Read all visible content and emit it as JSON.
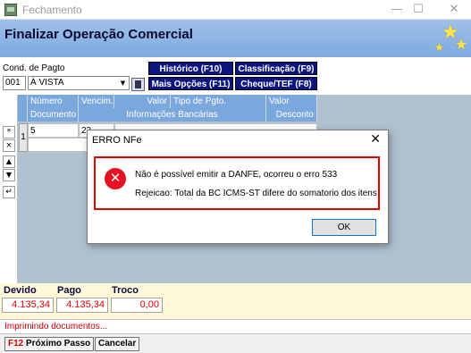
{
  "window": {
    "title": "Fechamento",
    "minimize": "—",
    "maximize": "☐",
    "close": "✕"
  },
  "header": {
    "title": "Finalizar Operação Comercial"
  },
  "payment": {
    "cond_label": "Cond. de Pagto",
    "code": "001",
    "selected": "À VISTA",
    "buttons": {
      "historico": "Histórico (F10)",
      "classificacao": "Classificação (F9)",
      "mais_opcoes": "Mais Opções (F11)",
      "cheque_tef": "Cheque/TEF (F8)"
    }
  },
  "grid": {
    "headers_row1": [
      "Número",
      "Vencim.",
      "Valor",
      "Tipo de Pgto.",
      "Valor Moeda"
    ],
    "headers_row2": [
      "Documento",
      "Informações Bancárias",
      "Desconto"
    ],
    "row": {
      "num": "1",
      "numero": "5",
      "vencim": "23"
    },
    "side_buttons": [
      "*",
      "×",
      "▲",
      "▼",
      "↵"
    ]
  },
  "totals": {
    "devido_label": "Devido",
    "devido": "4.135,34",
    "pago_label": "Pago",
    "pago": "4.135,34",
    "troco_label": "Troco",
    "troco": "0,00"
  },
  "status": {
    "text": "Imprimindo documentos..."
  },
  "footer": {
    "next_key": "F12",
    "next_label": "Próximo Passo",
    "cancel_label": "Cancelar"
  },
  "dialog": {
    "title": "ERRO NFe",
    "line1": "Não é possível emitir a DANFE, ocorreu o erro 533",
    "line2": "Rejeicao: Total da BC ICMS-ST difere do somatorio dos itens",
    "ok": "OK",
    "close": "✕"
  }
}
